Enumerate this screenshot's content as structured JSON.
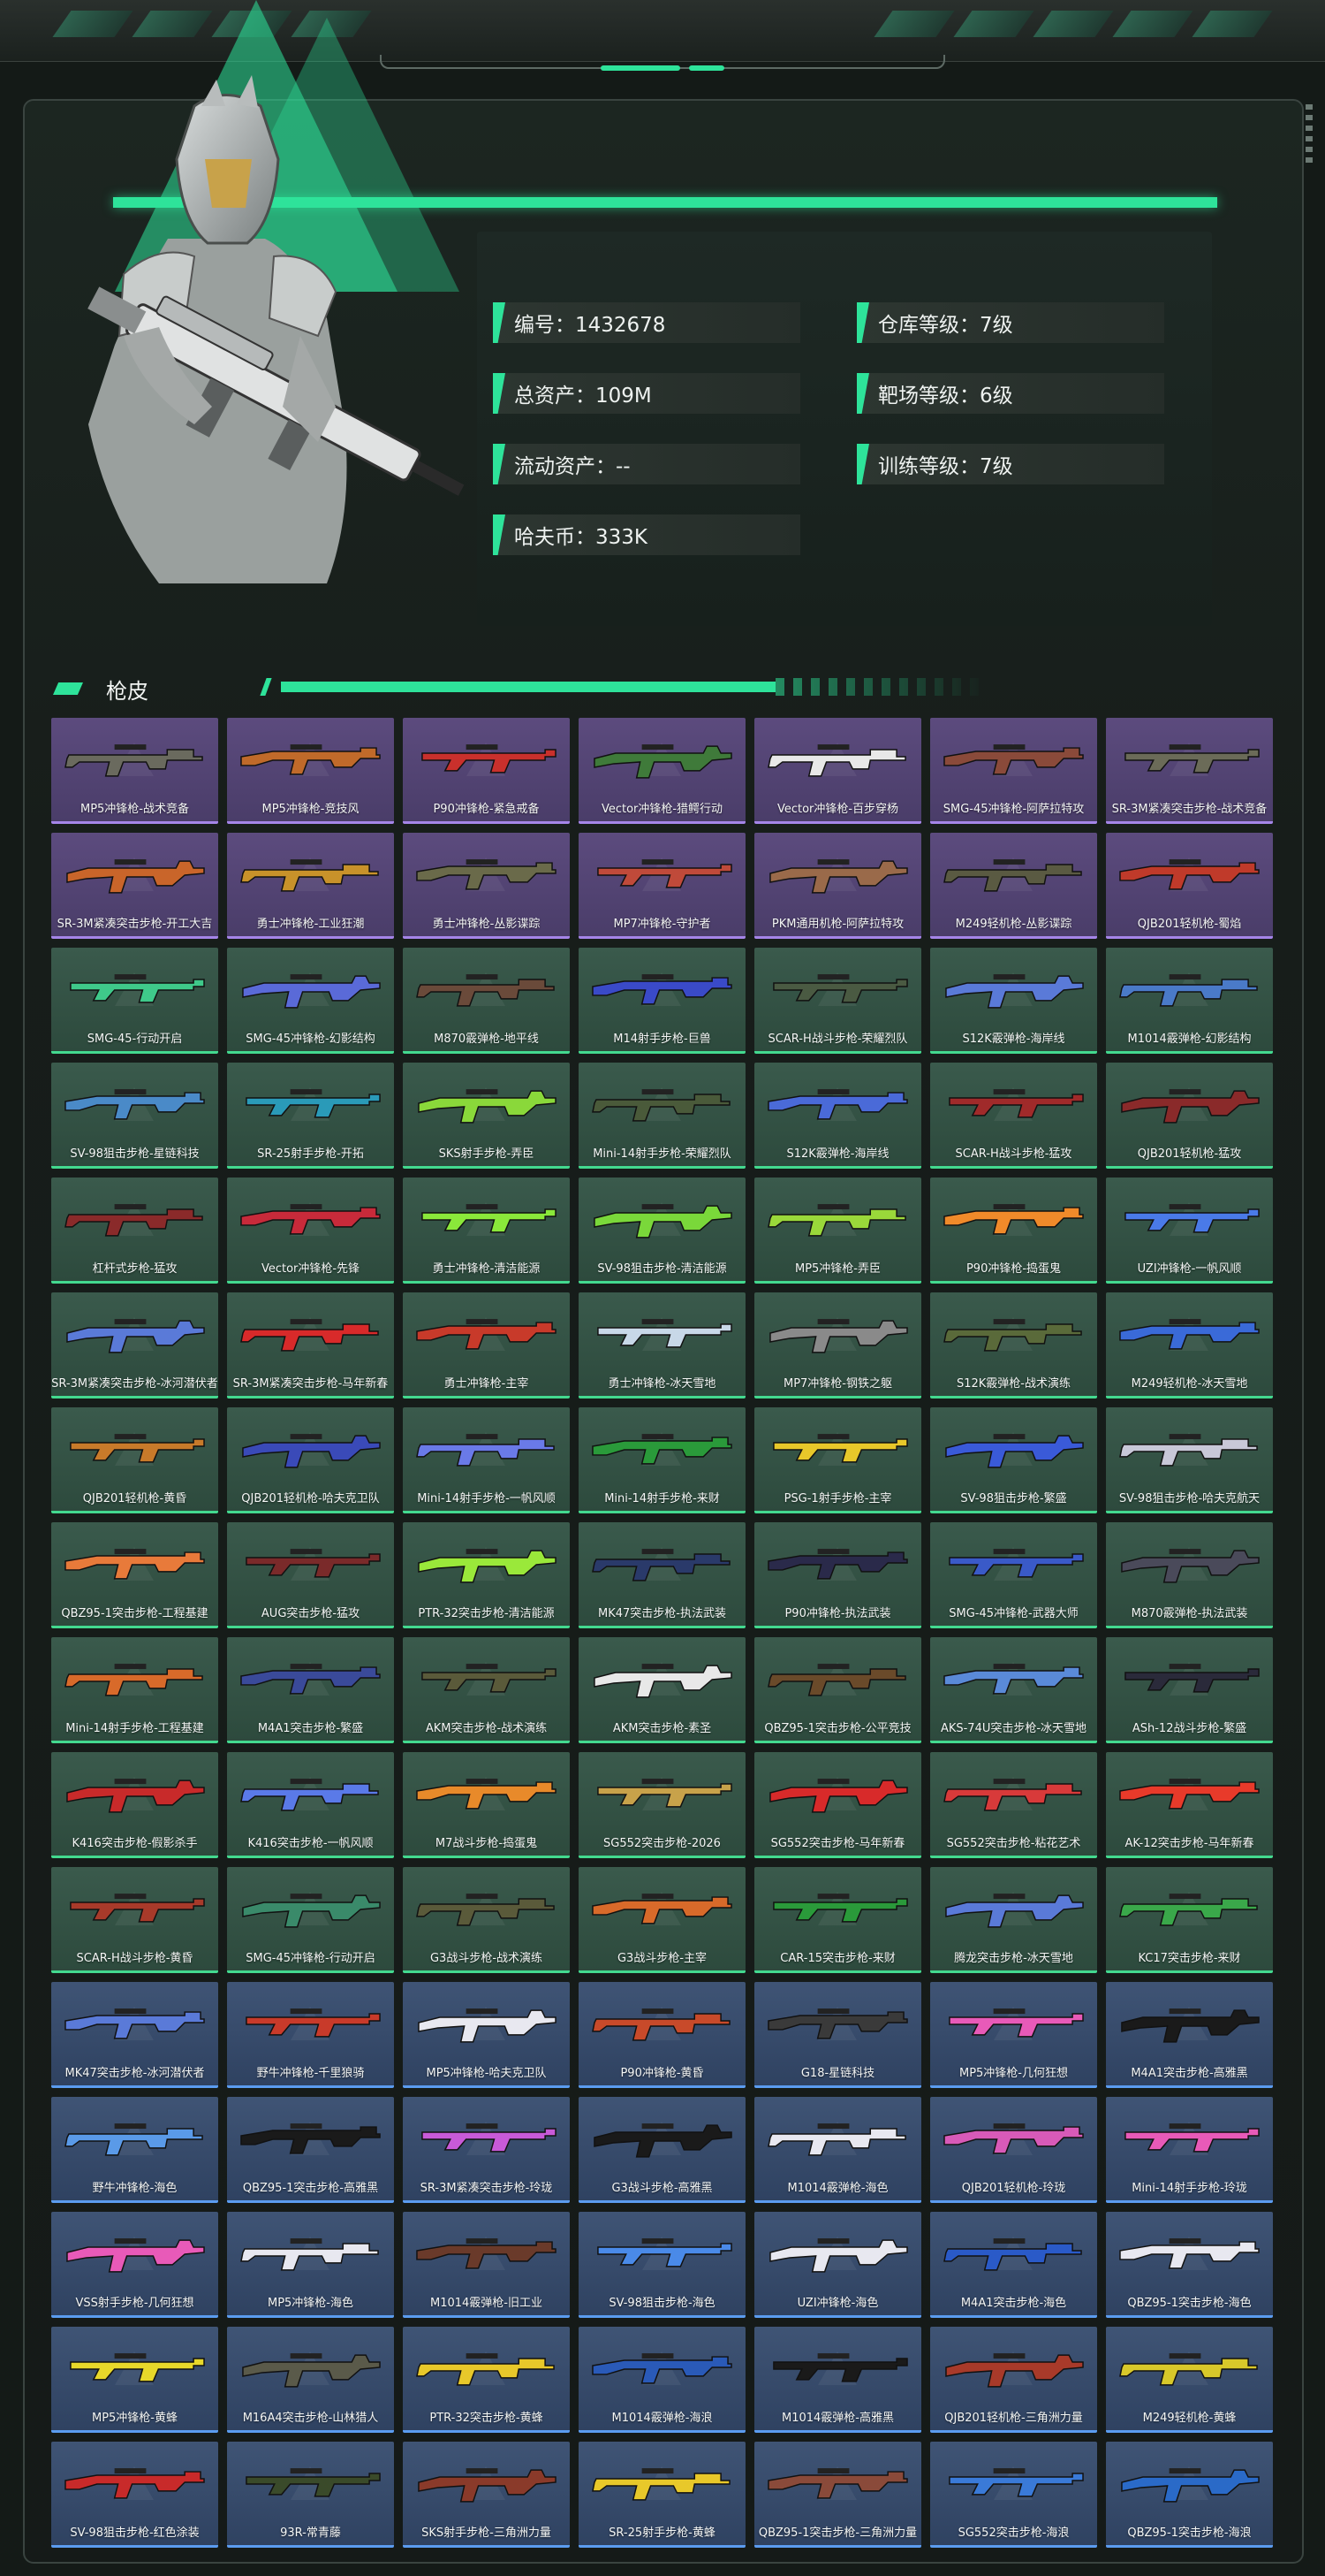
{
  "profile": {
    "items": [
      {
        "label": "编号",
        "value": "1432678"
      },
      {
        "label": "仓库等级",
        "value": "7级"
      },
      {
        "label": "总资产",
        "value": "109M"
      },
      {
        "label": "靶场等级",
        "value": "6级"
      },
      {
        "label": "流动资产",
        "value": "--"
      },
      {
        "label": "训练等级",
        "value": "7级"
      },
      {
        "label": "哈夫币",
        "value": "333K"
      }
    ]
  },
  "section": {
    "title": "枪皮"
  },
  "colors": {
    "accent": "#2ee39a",
    "purple": "#a585e8",
    "green": "#43d98f",
    "blue": "#5b9cf0"
  },
  "skins": [
    {
      "name": "MP5冲锋枪-战术竞备",
      "rarity": "purple",
      "color": "#6a6a5e"
    },
    {
      "name": "MP5冲锋枪-竞技风",
      "rarity": "purple",
      "color": "#c06a2a"
    },
    {
      "name": "P90冲锋枪-紧急戒备",
      "rarity": "purple",
      "color": "#c9302c"
    },
    {
      "name": "Vector冲锋枪-猎鳄行动",
      "rarity": "purple",
      "color": "#3f7a3a"
    },
    {
      "name": "Vector冲锋枪-百步穿杨",
      "rarity": "purple",
      "color": "#e8e8e8"
    },
    {
      "name": "SMG-45冲锋枪-阿萨拉特攻",
      "rarity": "purple",
      "color": "#8a4a3a"
    },
    {
      "name": "SR-3M紧凑突击步枪-战术竞备",
      "rarity": "purple",
      "color": "#6b6b58"
    },
    {
      "name": "SR-3M紧凑突击步枪-开工大吉",
      "rarity": "purple",
      "color": "#c9652a"
    },
    {
      "name": "勇士冲锋枪-工业狂潮",
      "rarity": "purple",
      "color": "#c8922a"
    },
    {
      "name": "勇士冲锋枪-丛影谍踪",
      "rarity": "purple",
      "color": "#6a6a4a"
    },
    {
      "name": "MP7冲锋枪-守护者",
      "rarity": "purple",
      "color": "#c04a3a"
    },
    {
      "name": "PKM通用机枪-阿萨拉特攻",
      "rarity": "purple",
      "color": "#9a6a4a"
    },
    {
      "name": "M249轻机枪-丛影谍踪",
      "rarity": "purple",
      "color": "#5a5a42"
    },
    {
      "name": "QJB201轻机枪-蜀焰",
      "rarity": "purple",
      "color": "#c03a2a"
    },
    {
      "name": "SMG-45-行动开启",
      "rarity": "green",
      "color": "#3fc98a"
    },
    {
      "name": "SMG-45冲锋枪-幻影结构",
      "rarity": "green",
      "color": "#5a6ad8"
    },
    {
      "name": "M870霰弹枪-地平线",
      "rarity": "green",
      "color": "#6a4a3a"
    },
    {
      "name": "M14射手步枪-巨兽",
      "rarity": "green",
      "color": "#3a4ac8"
    },
    {
      "name": "SCAR-H战斗步枪-荣耀烈队",
      "rarity": "green",
      "color": "#4a5a42"
    },
    {
      "name": "S12K霰弹枪-海岸线",
      "rarity": "green",
      "color": "#5a7ad8"
    },
    {
      "name": "M1014霰弹枪-幻影结构",
      "rarity": "green",
      "color": "#4a7ac8"
    },
    {
      "name": "SV-98狙击步枪-星链科技",
      "rarity": "green",
      "color": "#4a8ac8"
    },
    {
      "name": "SR-25射手步枪-开拓",
      "rarity": "green",
      "color": "#2a9ab8"
    },
    {
      "name": "SKS射手步枪-弄臣",
      "rarity": "green",
      "color": "#8ad83a"
    },
    {
      "name": "Mini-14射手步枪-荣耀烈队",
      "rarity": "green",
      "color": "#4a5a3a"
    },
    {
      "name": "S12K霰弹枪-海岸线",
      "rarity": "green",
      "color": "#4a6ad8"
    },
    {
      "name": "SCAR-H战斗步枪-猛攻",
      "rarity": "green",
      "color": "#a02a2a"
    },
    {
      "name": "QJB201轻机枪-猛攻",
      "rarity": "green",
      "color": "#8a2a2a"
    },
    {
      "name": "杠杆式步枪-猛攻",
      "rarity": "green",
      "color": "#8a2a2a"
    },
    {
      "name": "Vector冲锋枪-先锋",
      "rarity": "green",
      "color": "#c82a3a"
    },
    {
      "name": "勇士冲锋枪-清洁能源",
      "rarity": "green",
      "color": "#8ae83a"
    },
    {
      "name": "SV-98狙击步枪-清洁能源",
      "rarity": "green",
      "color": "#7ad83a"
    },
    {
      "name": "MP5冲锋枪-弄臣",
      "rarity": "green",
      "color": "#9ad83a"
    },
    {
      "name": "P90冲锋枪-捣蛋鬼",
      "rarity": "green",
      "color": "#f08a2a"
    },
    {
      "name": "UZI冲锋枪-一帆风顺",
      "rarity": "green",
      "color": "#4a7ae8"
    },
    {
      "name": "SR-3M紧凑突击步枪-冰河潜伏者",
      "rarity": "green",
      "color": "#5a7ad8"
    },
    {
      "name": "SR-3M紧凑突击步枪-马年新春",
      "rarity": "green",
      "color": "#d82a2a"
    },
    {
      "name": "勇士冲锋枪-主宰",
      "rarity": "green",
      "color": "#c83a2a"
    },
    {
      "name": "勇士冲锋枪-冰天雪地",
      "rarity": "green",
      "color": "#c8d8e8"
    },
    {
      "name": "MP7冲锋枪-钢铁之躯",
      "rarity": "green",
      "color": "#8a8a8a"
    },
    {
      "name": "S12K霰弹枪-战术演练",
      "rarity": "green",
      "color": "#5a6a3a"
    },
    {
      "name": "M249轻机枪-冰天雪地",
      "rarity": "green",
      "color": "#3a6ad8"
    },
    {
      "name": "QJB201轻机枪-黄昏",
      "rarity": "green",
      "color": "#c87a2a"
    },
    {
      "name": "QJB201轻机枪-哈夫克卫队",
      "rarity": "green",
      "color": "#3a4ab8"
    },
    {
      "name": "Mini-14射手步枪-一帆风顺",
      "rarity": "green",
      "color": "#6a7ae8"
    },
    {
      "name": "Mini-14射手步枪-来财",
      "rarity": "green",
      "color": "#2a9a3a"
    },
    {
      "name": "PSG-1射手步枪-主宰",
      "rarity": "green",
      "color": "#e8c82a"
    },
    {
      "name": "SV-98狙击步枪-繁盛",
      "rarity": "green",
      "color": "#3a5ad8"
    },
    {
      "name": "SV-98狙击步枪-哈夫克航天",
      "rarity": "green",
      "color": "#c8c8d8"
    },
    {
      "name": "QBZ95-1突击步枪-工程基建",
      "rarity": "green",
      "color": "#e87a3a"
    },
    {
      "name": "AUG突击步枪-猛攻",
      "rarity": "green",
      "color": "#7a2a2a"
    },
    {
      "name": "PTR-32突击步枪-清洁能源",
      "rarity": "green",
      "color": "#9ae83a"
    },
    {
      "name": "MK47突击步枪-执法武装",
      "rarity": "green",
      "color": "#2a3a6a"
    },
    {
      "name": "P90冲锋枪-执法武装",
      "rarity": "green",
      "color": "#2a2a4a"
    },
    {
      "name": "SMG-45冲锋枪-武器大师",
      "rarity": "green",
      "color": "#3a5ac8"
    },
    {
      "name": "M870霰弹枪-执法武装",
      "rarity": "green",
      "color": "#4a4a5a"
    },
    {
      "name": "Mini-14射手步枪-工程基建",
      "rarity": "green",
      "color": "#d86a2a"
    },
    {
      "name": "M4A1突击步枪-繁盛",
      "rarity": "green",
      "color": "#3a4a9a"
    },
    {
      "name": "AKM突击步枪-战术演练",
      "rarity": "green",
      "color": "#5a5a3a"
    },
    {
      "name": "AKM突击步枪-素圣",
      "rarity": "green",
      "color": "#e8e8e8"
    },
    {
      "name": "QBZ95-1突击步枪-公平竞技",
      "rarity": "green",
      "color": "#6a4a2a"
    },
    {
      "name": "AKS-74U突击步枪-冰天雪地",
      "rarity": "green",
      "color": "#5a8ad8"
    },
    {
      "name": "ASh-12战斗步枪-繁盛",
      "rarity": "green",
      "color": "#2a2a3a"
    },
    {
      "name": "K416突击步枪-假影杀手",
      "rarity": "green",
      "color": "#c82a2a"
    },
    {
      "name": "K416突击步枪-一帆风顺",
      "rarity": "green",
      "color": "#5a7ae8"
    },
    {
      "name": "M7战斗步枪-捣蛋鬼",
      "rarity": "green",
      "color": "#e88a2a"
    },
    {
      "name": "SG552突击步枪-2026",
      "rarity": "green",
      "color": "#c8a24a"
    },
    {
      "name": "SG552突击步枪-马年新春",
      "rarity": "green",
      "color": "#d82a2a"
    },
    {
      "name": "SG552突击步枪-粘花艺术",
      "rarity": "green",
      "color": "#d83a3a"
    },
    {
      "name": "AK-12突击步枪-马年新春",
      "rarity": "green",
      "color": "#e83a2a"
    },
    {
      "name": "SCAR-H战斗步枪-黄昏",
      "rarity": "green",
      "color": "#a83a2a"
    },
    {
      "name": "SMG-45冲锋枪-行动开启",
      "rarity": "green",
      "color": "#3a8a6a"
    },
    {
      "name": "G3战斗步枪-战术演练",
      "rarity": "green",
      "color": "#5a5a3a"
    },
    {
      "name": "G3战斗步枪-主宰",
      "rarity": "green",
      "color": "#d86a2a"
    },
    {
      "name": "CAR-15突击步枪-来财",
      "rarity": "green",
      "color": "#2a9a3a"
    },
    {
      "name": "腾龙突击步枪-冰天雪地",
      "rarity": "green",
      "color": "#5a7ad8"
    },
    {
      "name": "KC17突击步枪-来财",
      "rarity": "green",
      "color": "#3aa84a"
    },
    {
      "name": "MK47突击步枪-冰河潜伏者",
      "rarity": "blue",
      "color": "#5a7ad8"
    },
    {
      "name": "野牛冲锋枪-千里狼骑",
      "rarity": "blue",
      "color": "#c83a2a"
    },
    {
      "name": "MP5冲锋枪-哈夫克卫队",
      "rarity": "blue",
      "color": "#e8e8f0"
    },
    {
      "name": "P90冲锋枪-黄昏",
      "rarity": "blue",
      "color": "#c84a2a"
    },
    {
      "name": "G18-星链科技",
      "rarity": "blue",
      "color": "#3a3a3a"
    },
    {
      "name": "MP5冲锋枪-几何狂想",
      "rarity": "blue",
      "color": "#e85ab8"
    },
    {
      "name": "M4A1突击步枪-高雅黑",
      "rarity": "blue",
      "color": "#1a1a1a"
    },
    {
      "name": "野牛冲锋枪-海色",
      "rarity": "blue",
      "color": "#5a9ae8"
    },
    {
      "name": "QBZ95-1突击步枪-高雅黑",
      "rarity": "blue",
      "color": "#1a1a1a"
    },
    {
      "name": "SR-3M紧凑突击步枪-玲珑",
      "rarity": "blue",
      "color": "#c85ad8"
    },
    {
      "name": "G3战斗步枪-高雅黑",
      "rarity": "blue",
      "color": "#1a1a1a"
    },
    {
      "name": "M1014霰弹枪-海色",
      "rarity": "blue",
      "color": "#e8e8f0"
    },
    {
      "name": "QJB201轻机枪-玲珑",
      "rarity": "blue",
      "color": "#d85ab8"
    },
    {
      "name": "Mini-14射手步枪-玲珑",
      "rarity": "blue",
      "color": "#e85ab8"
    },
    {
      "name": "VSS射手步枪-几何狂想",
      "rarity": "blue",
      "color": "#e85ab8"
    },
    {
      "name": "MP5冲锋枪-海色",
      "rarity": "blue",
      "color": "#e8e8f0"
    },
    {
      "name": "M1014霰弹枪-旧工业",
      "rarity": "blue",
      "color": "#6a3a2a"
    },
    {
      "name": "SV-98狙击步枪-海色",
      "rarity": "blue",
      "color": "#4a8ae8"
    },
    {
      "name": "UZI冲锋枪-海色",
      "rarity": "blue",
      "color": "#e8e8f0"
    },
    {
      "name": "M4A1突击步枪-海色",
      "rarity": "blue",
      "color": "#2a5ac8"
    },
    {
      "name": "QBZ95-1突击步枪-海色",
      "rarity": "blue",
      "color": "#e8e8f0"
    },
    {
      "name": "MP5冲锋枪-黄蜂",
      "rarity": "blue",
      "color": "#e8d82a"
    },
    {
      "name": "M16A4突击步枪-山林猎人",
      "rarity": "blue",
      "color": "#5a5a4a"
    },
    {
      "name": "PTR-32突击步枪-黄蜂",
      "rarity": "blue",
      "color": "#e8c82a"
    },
    {
      "name": "M1014霰弹枪-海浪",
      "rarity": "blue",
      "color": "#2a5ab8"
    },
    {
      "name": "M1014霰弹枪-高雅黑",
      "rarity": "blue",
      "color": "#1a1a1a"
    },
    {
      "name": "QJB201轻机枪-三角洲力量",
      "rarity": "blue",
      "color": "#a83a2a"
    },
    {
      "name": "M249轻机枪-黄蜂",
      "rarity": "blue",
      "color": "#d8c82a"
    },
    {
      "name": "SV-98狙击步枪-红色涂装",
      "rarity": "blue",
      "color": "#c82a2a"
    },
    {
      "name": "93R-常青藤",
      "rarity": "blue",
      "color": "#3a4a2a"
    },
    {
      "name": "SKS射手步枪-三角洲力量",
      "rarity": "blue",
      "color": "#8a3a2a"
    },
    {
      "name": "SR-25射手步枪-黄蜂",
      "rarity": "blue",
      "color": "#e8c82a"
    },
    {
      "name": "QBZ95-1突击步枪-三角洲力量",
      "rarity": "blue",
      "color": "#8a4a3a"
    },
    {
      "name": "SG552突击步枪-海浪",
      "rarity": "blue",
      "color": "#3a7ad8"
    },
    {
      "name": "QBZ95-1突击步枪-海浪",
      "rarity": "blue",
      "color": "#2a6ac8"
    }
  ]
}
